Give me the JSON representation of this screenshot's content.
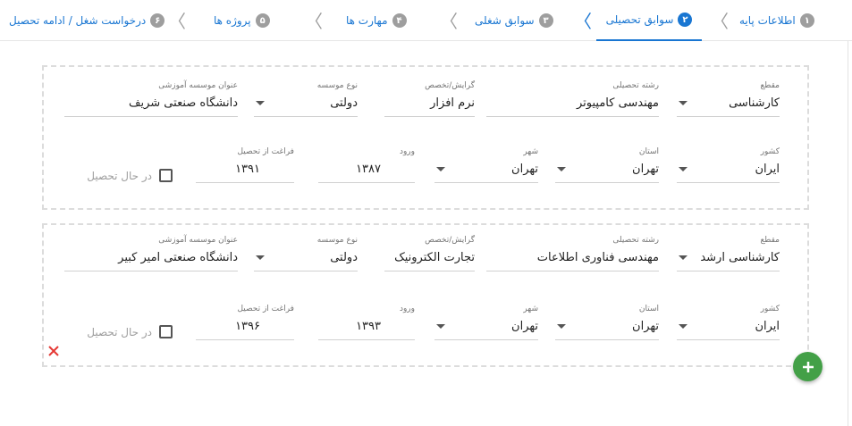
{
  "steps": [
    {
      "num": "۱",
      "label": "اطلاعات پایه"
    },
    {
      "num": "۲",
      "label": "سوابق تحصیلی"
    },
    {
      "num": "۳",
      "label": "سوابق شغلی"
    },
    {
      "num": "۴",
      "label": "مهارت ها"
    },
    {
      "num": "۵",
      "label": "پروژه ها"
    },
    {
      "num": "۶",
      "label": "درخواست شغل / ادامه تحصیل"
    }
  ],
  "labels": {
    "degree": "مقطع",
    "major": "رشته تحصیلی",
    "orientation": "گرایش/تخصص",
    "inst_type": "نوع موسسه",
    "inst_name": "عنوان موسسه آموزشی",
    "country": "کشور",
    "province": "استان",
    "city": "شهر",
    "entry": "ورود",
    "graduation": "فراغت از تحصیل",
    "studying": "در حال تحصیل"
  },
  "records": [
    {
      "degree": "کارشناسی",
      "major": "مهندسی کامپیوتر",
      "orientation": "نرم افزار",
      "inst_type": "دولتی",
      "inst_name": "دانشگاه صنعتی شریف",
      "country": "ایران",
      "province": "تهران",
      "city": "تهران",
      "entry": "۱۳۸۷",
      "graduation": "۱۳۹۱",
      "studying": false
    },
    {
      "degree": "کارشناسی ارشد",
      "major": "مهندسی فناوری اطلاعات",
      "orientation": "تجارت الکترونیک",
      "inst_type": "دولتی",
      "inst_name": "دانشگاه صنعتی امیر کبیر",
      "country": "ایران",
      "province": "تهران",
      "city": "تهران",
      "entry": "۱۳۹۳",
      "graduation": "۱۳۹۶",
      "studying": false
    }
  ],
  "icons": {
    "remove": "close-icon",
    "add": "plus-icon",
    "separator": "chevron-left-icon"
  },
  "colors": {
    "accent": "#1976d2",
    "step_inactive": "#9e9e9e",
    "add_button": "#43a047",
    "remove_icon": "#e53935"
  }
}
